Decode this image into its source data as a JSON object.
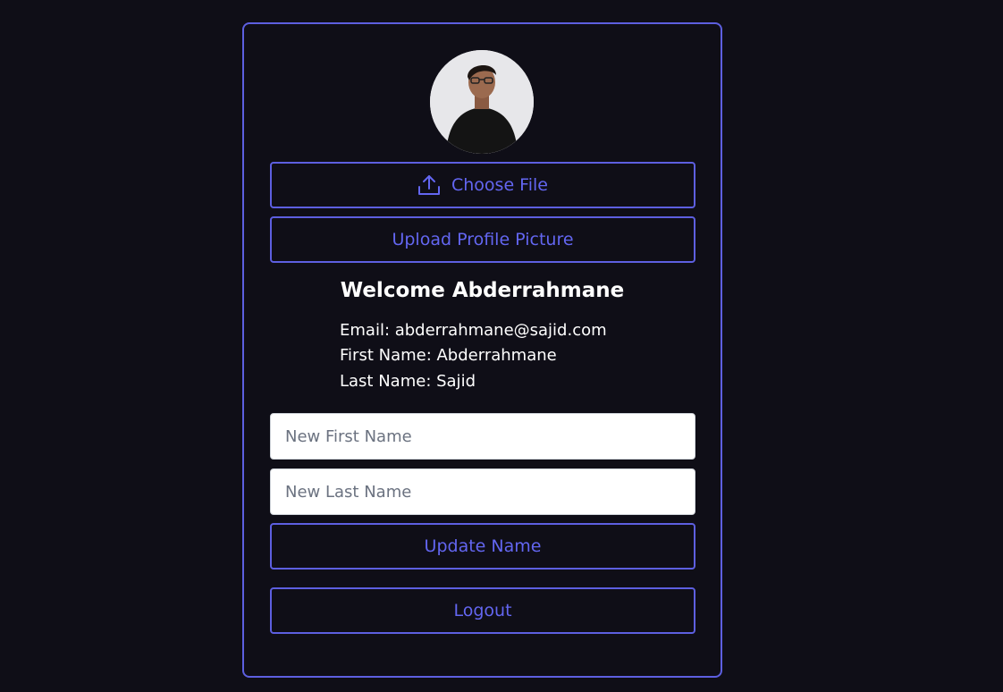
{
  "profile": {
    "avatar_alt": "profile picture",
    "choose_file_label": "Choose File",
    "upload_label": "Upload Profile Picture"
  },
  "welcome": {
    "title": "Welcome Abderrahmane",
    "email_line": "Email: abderrahmane@sajid.com",
    "first_name_line": "First Name: Abderrahmane",
    "last_name_line": "Last Name: Sajid"
  },
  "form": {
    "first_name_placeholder": "New First Name",
    "first_name_value": "",
    "last_name_placeholder": "New Last Name",
    "last_name_value": "",
    "update_label": "Update Name"
  },
  "logout_label": "Logout",
  "icons": {
    "upload": "upload-icon"
  },
  "colors": {
    "background": "#0f0e17",
    "accent": "#6366f1",
    "border": "#5d5fe0",
    "text": "#ffffff"
  }
}
